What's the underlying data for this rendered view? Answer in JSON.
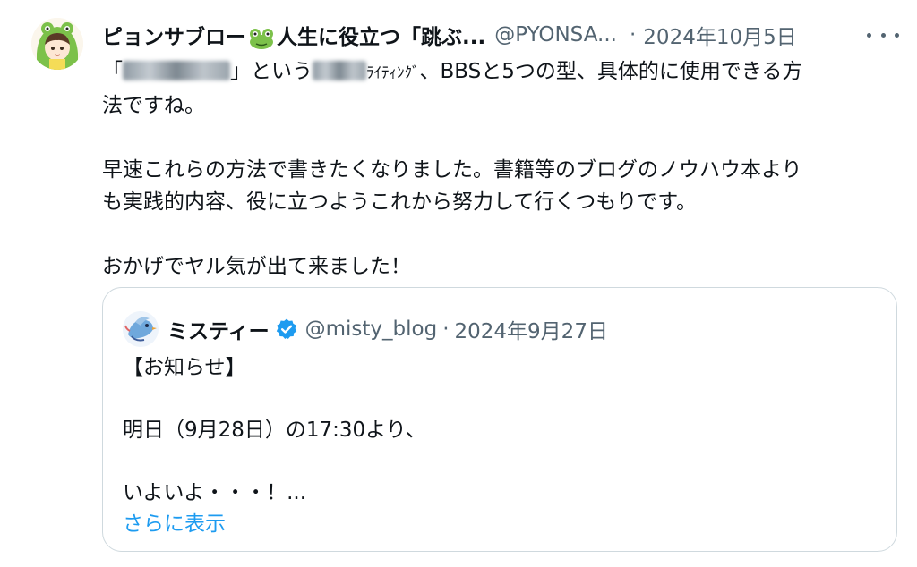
{
  "tweet": {
    "display_name_part1": "ピョンサブロー",
    "display_name_part2": "人生に役立つ「跳ぶ...",
    "frog_emoji": "frog-emoji",
    "handle": "@PYONSA...",
    "separator": "·",
    "date": "2024年10月5日",
    "more_icon": "more-horizontal-icon",
    "text": {
      "line1_open": "「",
      "line1_mid1": "」という",
      "line1_kana": "ﾗｲﾃｨﾝｸﾞ",
      "line1_rest": "、BBSと5つの型、具体的に使用できる方",
      "line2": "法ですね。",
      "line3": "早速これらの方法で書きたくなりました。書籍等のブログのノウハウ本より",
      "line4": "も実践的内容、役に立つようこれから努力して行くつもりです。",
      "line5": "おかげでヤル気が出て来ました！"
    }
  },
  "quote": {
    "display_name": "ミスティー",
    "verified_icon": "verified-badge-icon",
    "handle": "@misty_blog",
    "separator": "·",
    "date": "2024年9月27日",
    "lines": {
      "line1": "【お知らせ】",
      "line2": "明日（9月28日）の17:30より、",
      "line3": "いよいよ・・・！..."
    },
    "show_more": "さらに表示"
  },
  "colors": {
    "text": "#0f1419",
    "secondary": "#536471",
    "link": "#1d9bf0",
    "border": "#cfd9de",
    "frog_green": "#7cc14a"
  }
}
